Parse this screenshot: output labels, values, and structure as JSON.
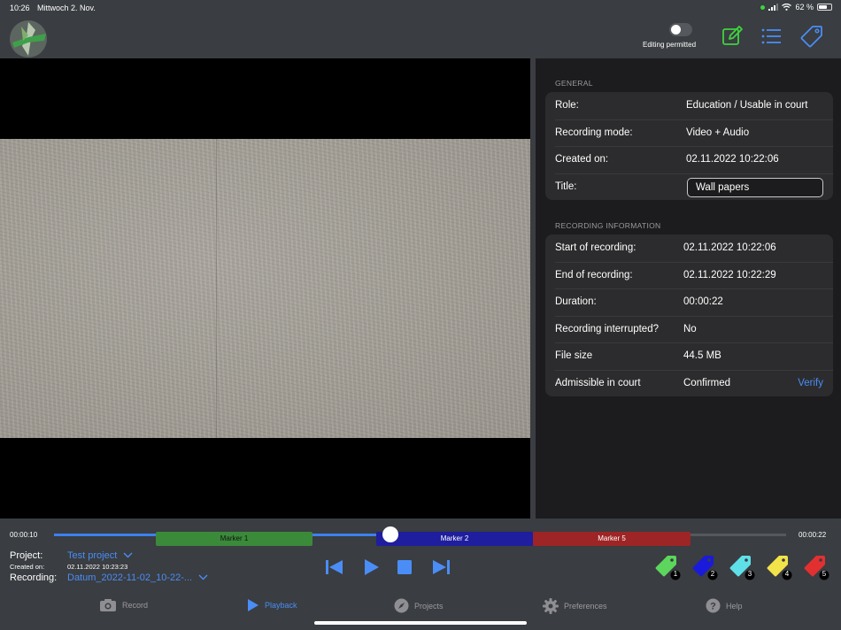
{
  "status_bar": {
    "time": "10:26",
    "date": "Mittwoch 2. Nov.",
    "battery": "62 %"
  },
  "toolbar": {
    "editing_label": "Editing permitted",
    "accent_color": "#4a8df6",
    "edit_icon_color": "#3ed43e"
  },
  "general": {
    "section_title": "GENERAL",
    "rows": [
      {
        "label": "Role:",
        "value": "Education / Usable in court"
      },
      {
        "label": "Recording mode:",
        "value": "Video + Audio"
      },
      {
        "label": "Created on:",
        "value": "02.11.2022 10:22:06"
      }
    ],
    "title_label": "Title:",
    "title_value": "Wall papers"
  },
  "recording_info": {
    "section_title": "RECORDING INFORMATION",
    "rows": [
      {
        "label": "Start of recording:",
        "value": "02.11.2022 10:22:06"
      },
      {
        "label": "End of recording:",
        "value": "02.11.2022 10:22:29"
      },
      {
        "label": "Duration:",
        "value": "00:00:22"
      },
      {
        "label": "Recording interrupted?",
        "value": "No"
      },
      {
        "label": "File size",
        "value": "44.5 MB"
      }
    ],
    "admissible_label": "Admissible in court",
    "admissible_value": "Confirmed",
    "verify_label": "Verify"
  },
  "timeline": {
    "current_time": "00:00:10",
    "total_time": "00:00:22",
    "progress": 0.46,
    "markers": [
      {
        "label": "Marker 1",
        "color": "#3a8a3a"
      },
      {
        "label": "Marker 2",
        "color": "#1e1e9e"
      },
      {
        "label": "Marker 5",
        "color": "#9e2525"
      }
    ]
  },
  "project": {
    "project_label": "Project:",
    "project_value": "Test project",
    "created_label": "Created on:",
    "created_value": "02.11.2022 10:23:23",
    "recording_label": "Recording:",
    "recording_value": "Datum_2022-11-02_10-22-..."
  },
  "tags": [
    {
      "number": "1",
      "color": "#5cd65c"
    },
    {
      "number": "2",
      "color": "#1a1adb"
    },
    {
      "number": "3",
      "color": "#5fe0e8"
    },
    {
      "number": "4",
      "color": "#f2e34a"
    },
    {
      "number": "5",
      "color": "#e23030"
    }
  ],
  "tabs": [
    {
      "label": "Record",
      "icon": "camera-icon"
    },
    {
      "label": "Playback",
      "icon": "play-icon"
    },
    {
      "label": "Projects",
      "icon": "compass-icon"
    },
    {
      "label": "Preferences",
      "icon": "gear-icon"
    },
    {
      "label": "Help",
      "icon": "help-icon"
    }
  ]
}
